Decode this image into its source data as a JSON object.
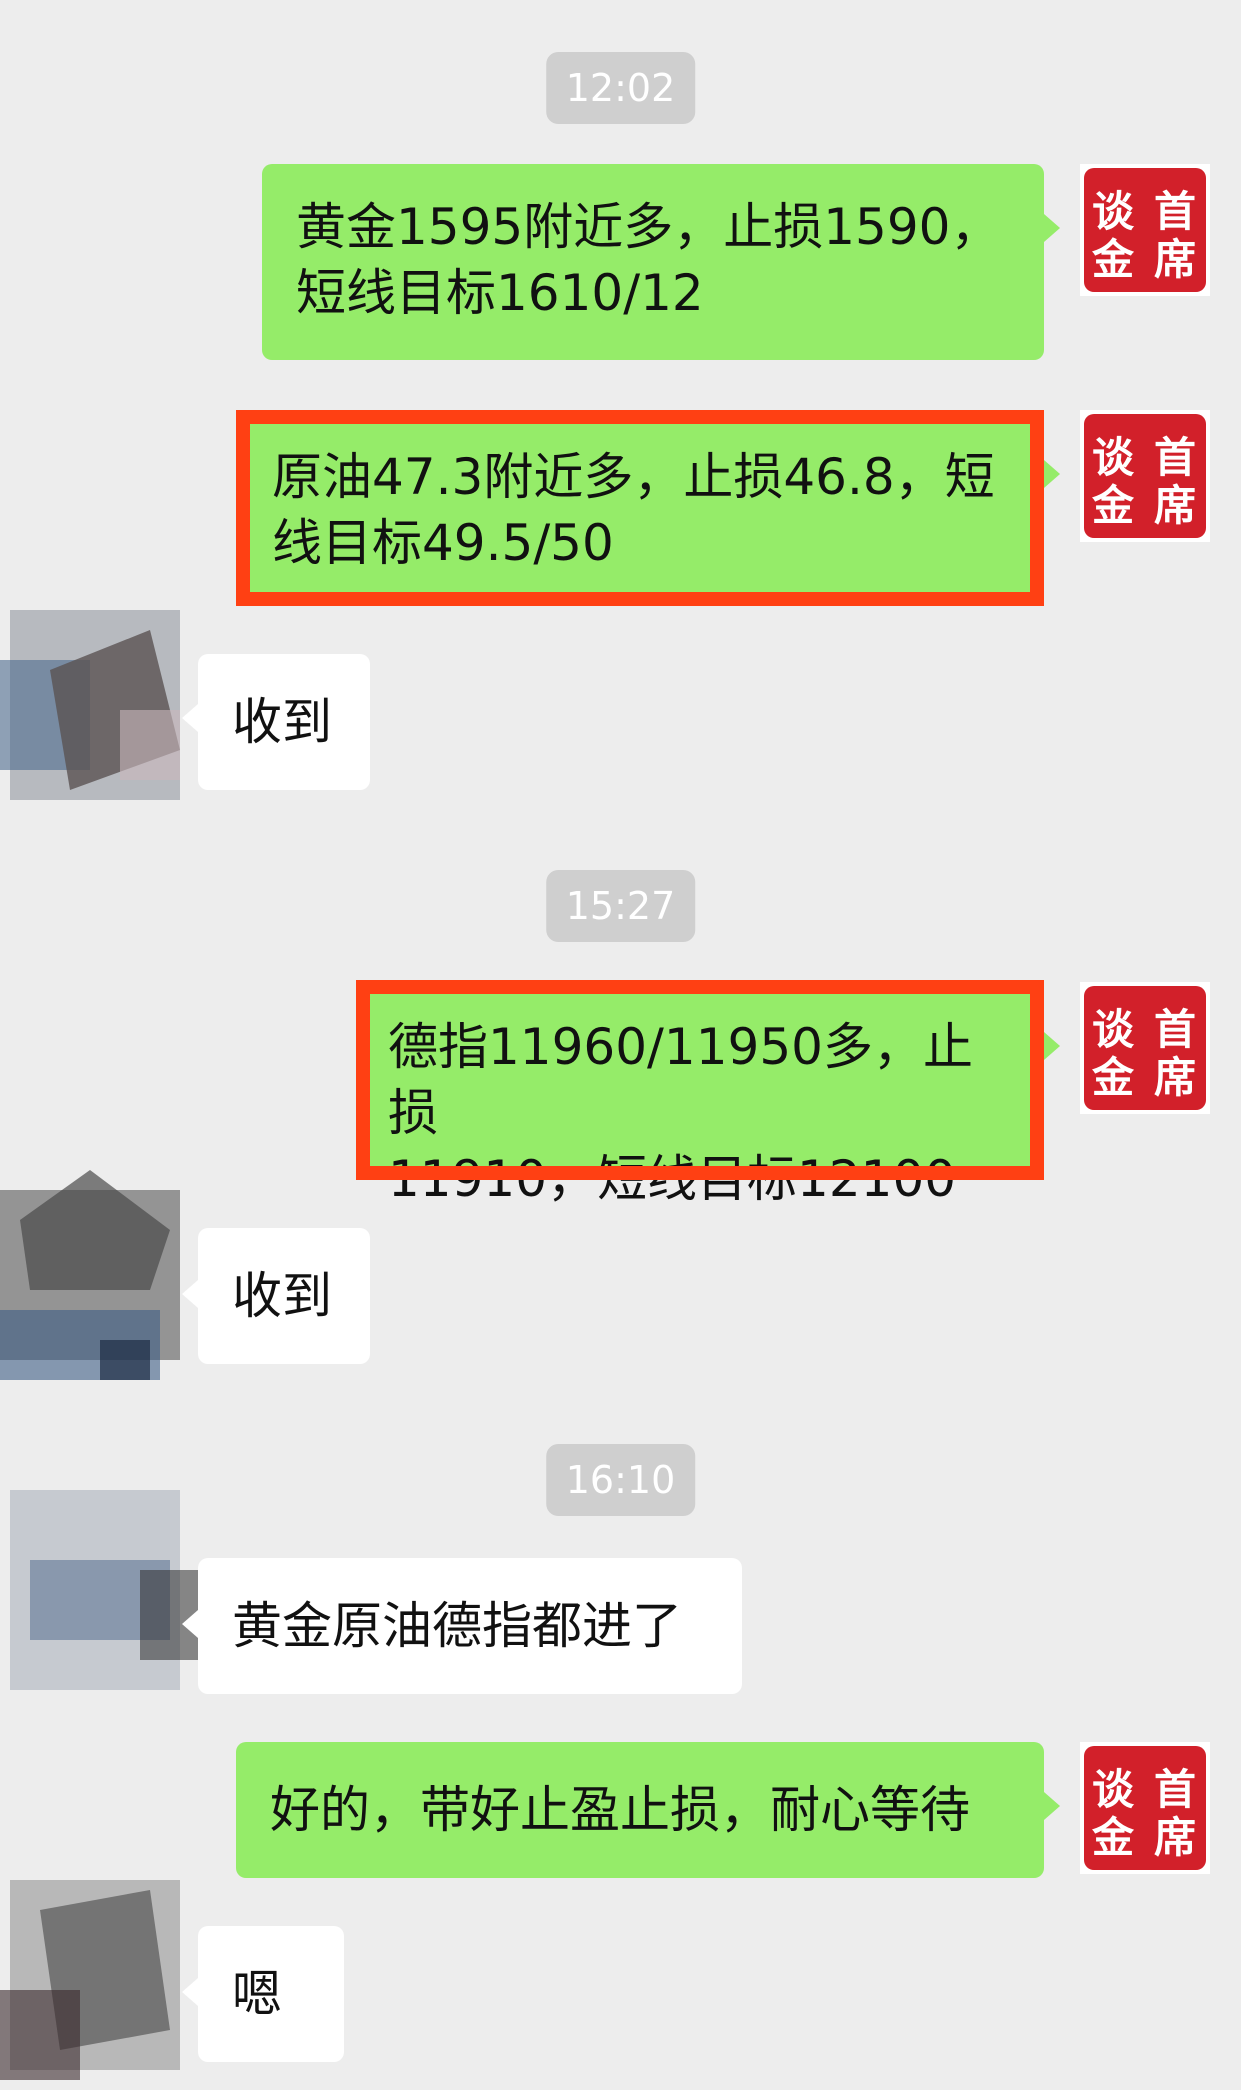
{
  "timestamps": [
    "12:02",
    "15:27",
    "16:10"
  ],
  "messages": [
    {
      "from": "self",
      "text": "黄金1595附近多，止损1590，\n短线目标1610/12"
    },
    {
      "from": "self",
      "text": "原油47.3附近多，止损46.8，短\n线目标49.5/50",
      "highlighted": true
    },
    {
      "from": "peer",
      "text": "收到"
    },
    {
      "from": "self",
      "text": "德指11960/11950多，止损\n11910，短线目标12100",
      "highlighted": true
    },
    {
      "from": "peer",
      "text": "收到"
    },
    {
      "from": "peer",
      "text": "黄金原油德指都进了"
    },
    {
      "from": "self",
      "text": "好的，带好止盈止损，耐心等待"
    },
    {
      "from": "peer",
      "text": "嗯"
    }
  ],
  "self_avatar": {
    "icon": "seal-stamp-icon",
    "text": "谈首金席"
  },
  "peer_avatar": {
    "icon": "blurred-avatar-icon"
  },
  "colors": {
    "background": "#ededed",
    "outgoing_bubble": "#95ec69",
    "incoming_bubble": "#ffffff",
    "highlight_frame": "#ff4013",
    "seal_red": "#d2202a",
    "timestamp_bg": "#cfcfcf"
  }
}
